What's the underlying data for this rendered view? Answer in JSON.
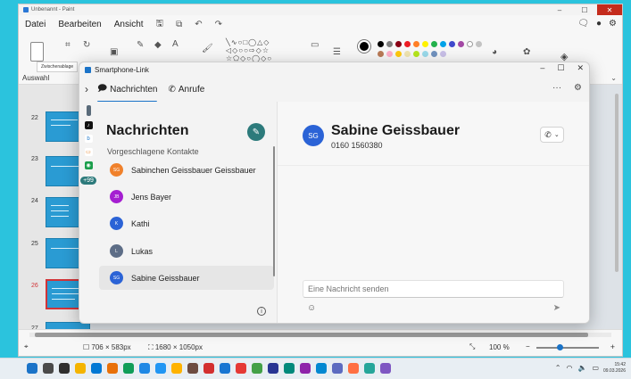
{
  "paint": {
    "title": "Unbenannt - Paint",
    "menu": [
      "Datei",
      "Bearbeiten",
      "Ansicht"
    ],
    "ribbon_label": "Auswahl",
    "tooltip": "Zwischenablage",
    "slide_numbers": [
      "22",
      "23",
      "24",
      "25",
      "26",
      "27"
    ],
    "status": {
      "canvas_size": "706 × 583px",
      "image_size": "1680 × 1050px",
      "zoom": "100 %"
    },
    "palette": [
      "#000000",
      "#7f7f7f",
      "#880015",
      "#ed1c24",
      "#ff7f27",
      "#fff200",
      "#22b14c",
      "#00a2e8",
      "#3f48cc",
      "#a349a4",
      "#ffffff",
      "#c3c3c3",
      "#b97a57",
      "#ffaec9",
      "#ffc90e",
      "#efe4b0",
      "#b5e61d",
      "#99d9ea",
      "#7092be",
      "#c8bfe7"
    ]
  },
  "phone_link": {
    "app_title": "Smartphone-Link",
    "tabs": [
      {
        "label": "Nachrichten",
        "icon": "chat-icon"
      },
      {
        "label": "Anrufe",
        "icon": "phone-icon"
      }
    ],
    "rail_badge": "+99",
    "conversations": {
      "heading": "Nachrichten",
      "subheading": "Vorgeschlagene Kontakte",
      "contacts": [
        {
          "initials": "SG",
          "name": "Sabinchen Geissbauer Geissbauer",
          "color": "#f0812b"
        },
        {
          "initials": "JB",
          "name": "Jens Bayer",
          "color": "#a51fd1"
        },
        {
          "initials": "K",
          "name": "Kathi",
          "color": "#2b63d6"
        },
        {
          "initials": "L",
          "name": "Lukas",
          "color": "#5d6d86"
        },
        {
          "initials": "SG",
          "name": "Sabine Geissbauer",
          "color": "#2b63d6"
        }
      ]
    },
    "chat": {
      "contact_initials": "SG",
      "contact_name": "Sabine Geissbauer",
      "contact_number": "0160 1560380",
      "input_placeholder": "Eine Nachricht senden"
    }
  },
  "taskbar": {
    "time": "15:42",
    "date": "09.03.2026",
    "app_colors": [
      "#1a73c8",
      "#4a4a4a",
      "#2f2f2f",
      "#f4b400",
      "#0078d4",
      "#e8710a",
      "#0f9d58",
      "#1e88e5",
      "#2196f3",
      "#ffb300",
      "#6d4c41",
      "#d32f2f",
      "#1976d2",
      "#e53935",
      "#43a047",
      "#283593",
      "#00897b",
      "#8e24aa",
      "#0288d1",
      "#5c6bc0",
      "#ff7043",
      "#26a69a",
      "#7e57c2"
    ]
  },
  "colors": {
    "accent": "#1a73c8",
    "compose": "#2c7a7b",
    "desktop": "#2bc3dd"
  }
}
